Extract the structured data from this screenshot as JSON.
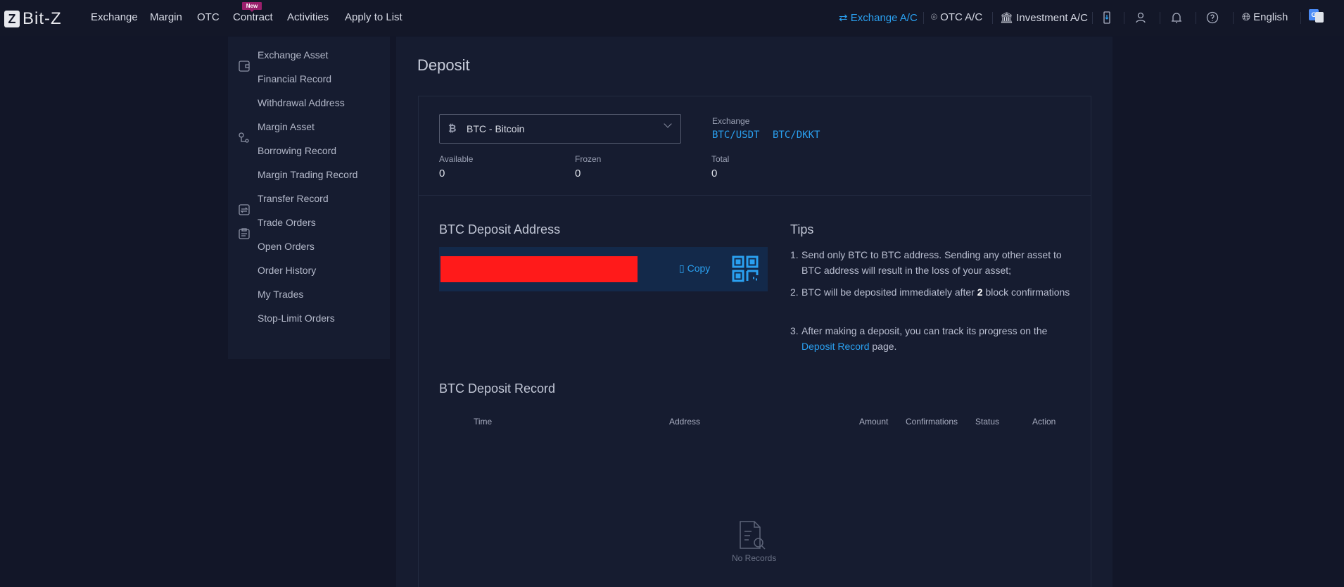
{
  "header": {
    "logo": "Bit-Z",
    "nav": [
      "Exchange",
      "Margin",
      "OTC",
      "Contract",
      "Activities",
      "Apply to List"
    ],
    "new_badge": "New",
    "accounts": [
      "Exchange A/C",
      "OTC A/C",
      "Investment A/C"
    ],
    "language": "English"
  },
  "sidebar": {
    "items": [
      "Exchange Asset",
      "Financial Record",
      "Withdrawal Address",
      "Margin Asset",
      "Borrowing Record",
      "Margin Trading Record",
      "Transfer Record",
      "Trade Orders",
      "Open Orders",
      "Order History",
      "My Trades",
      "Stop-Limit Orders"
    ]
  },
  "main": {
    "title": "Deposit",
    "coin_select": "BTC - Bitcoin",
    "exchange_label": "Exchange",
    "pairs": [
      "BTC/USDT",
      "BTC/DKKT"
    ],
    "balances": [
      {
        "label": "Available",
        "value": "0"
      },
      {
        "label": "Frozen",
        "value": "0"
      },
      {
        "label": "Total",
        "value": "0"
      }
    ],
    "address_title": "BTC Deposit Address",
    "copy": "Copy",
    "tips_title": "Tips",
    "tips": [
      {
        "n": "1.",
        "text": "Send only BTC to BTC address. Sending any other asset to BTC address will result in the loss of your asset;"
      },
      {
        "n": "2.",
        "pre": "BTC will be deposited immediately after ",
        "bold": "2",
        "post": " block confirmations"
      },
      {
        "n": "3.",
        "pre": "After making a deposit, you can track its progress on the ",
        "link": "Deposit Record",
        "post": " page."
      }
    ],
    "record_title": "BTC Deposit Record",
    "columns": [
      "Time",
      "Address",
      "Amount",
      "Confirmations",
      "Status",
      "Action"
    ],
    "empty": "No Records"
  },
  "colors": {
    "accent": "#2aa0f0",
    "redaction": "#ff1a1a",
    "badge": "#9a1f6c"
  }
}
